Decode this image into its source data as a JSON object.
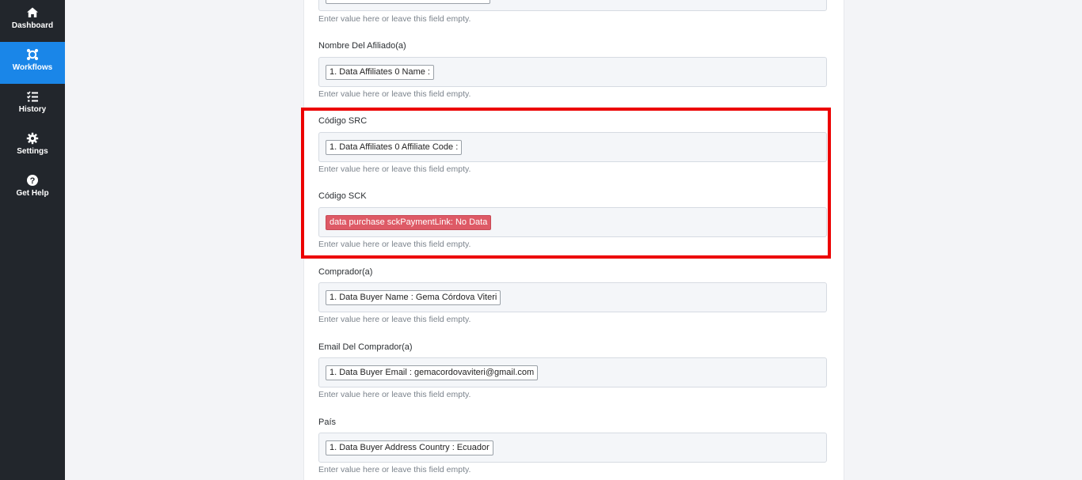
{
  "sidebar": {
    "items": [
      {
        "label": "Dashboard",
        "icon": "home-icon"
      },
      {
        "label": "Workflows",
        "icon": "workflows-icon",
        "active": true
      },
      {
        "label": "History",
        "icon": "history-icon"
      },
      {
        "label": "Settings",
        "icon": "gear-icon"
      },
      {
        "label": "Get Help",
        "icon": "help-icon"
      }
    ]
  },
  "helper_text": "Enter value here or leave this field empty.",
  "fields": [
    {
      "label": "Nombre Del Afiliado(a)",
      "value": "1. Data Affiliates 0 Name :"
    },
    {
      "label": "Código SRC",
      "value": "1. Data Affiliates 0 Affiliate Code :"
    },
    {
      "label": "Código SCK",
      "value": "data purchase sckPaymentLink: No Data"
    },
    {
      "label": "Comprador(a)",
      "value": "1. Data Buyer Name : Gema Córdova Viteri"
    },
    {
      "label": "Email Del Comprador(a)",
      "value": "1. Data Buyer Email : gemacordovaviteri@gmail.com"
    },
    {
      "label": "País",
      "value": "1. Data Buyer Address Country : Ecuador"
    }
  ],
  "colors": {
    "sidebar": "#22262c",
    "active": "#1a86e8",
    "highlight": "#ec0000",
    "error_pill": "#de5a66"
  }
}
